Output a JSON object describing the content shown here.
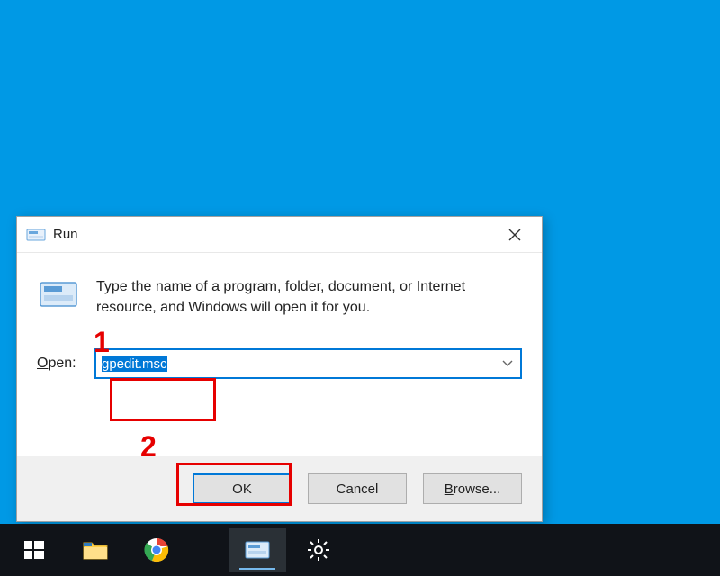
{
  "dialog": {
    "title": "Run",
    "description": "Type the name of a program, folder, document, or Internet resource, and Windows will open it for you.",
    "open_label_prefix": "O",
    "open_label_rest": "pen:",
    "input_value": "gpedit.msc",
    "ok_label": "OK",
    "cancel_label": "Cancel",
    "browse_prefix": "B",
    "browse_rest": "rowse..."
  },
  "annotations": {
    "step1": "1",
    "step2": "2"
  },
  "taskbar": {
    "start": "start-icon",
    "explorer": "file-explorer-icon",
    "chrome": "chrome-icon",
    "run": "run-dialog-icon",
    "settings": "settings-icon"
  }
}
